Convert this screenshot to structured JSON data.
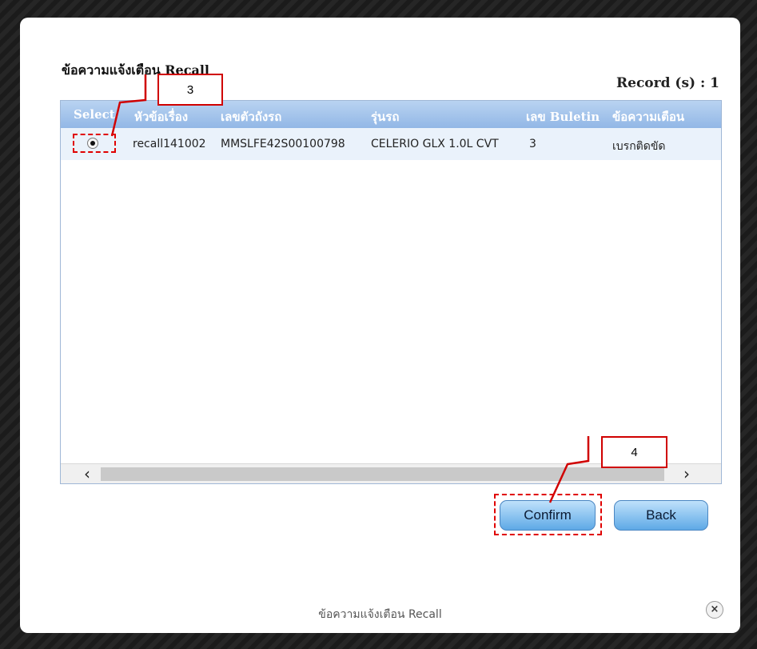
{
  "dialog": {
    "title": "ข้อความแจ้งเตือน Recall",
    "record_count": "Record (s) : 1",
    "footer_title": "ข้อความแจ้งเตือน Recall"
  },
  "table": {
    "columns": [
      "Select",
      "หัวข้อเรื่อง",
      "เลขตัวถังรถ",
      "รุ่นรถ",
      "เลข Buletin",
      "ข้อความเตือน"
    ],
    "rows": [
      {
        "selected": true,
        "subject": "recall141002",
        "vin": "MMSLFE42S00100798",
        "model": "CELERIO GLX 1.0L CVT",
        "bulletin": "3",
        "message": "เบรกติดขัด"
      }
    ]
  },
  "buttons": {
    "confirm": "Confirm",
    "back": "Back"
  },
  "scrollbar": {
    "left_arrow": "‹",
    "right_arrow": "›"
  },
  "close_glyph": "×",
  "annotations": {
    "step3": "3",
    "step4": "4"
  },
  "colors": {
    "header_bg": "#92b7e6",
    "row_bg": "#eaf2fb",
    "annotation": "#d00000",
    "button": "#5ea9e6"
  },
  "icons": [
    "radio-selected-icon",
    "scroll-left-icon",
    "scroll-right-icon",
    "close-icon"
  ]
}
